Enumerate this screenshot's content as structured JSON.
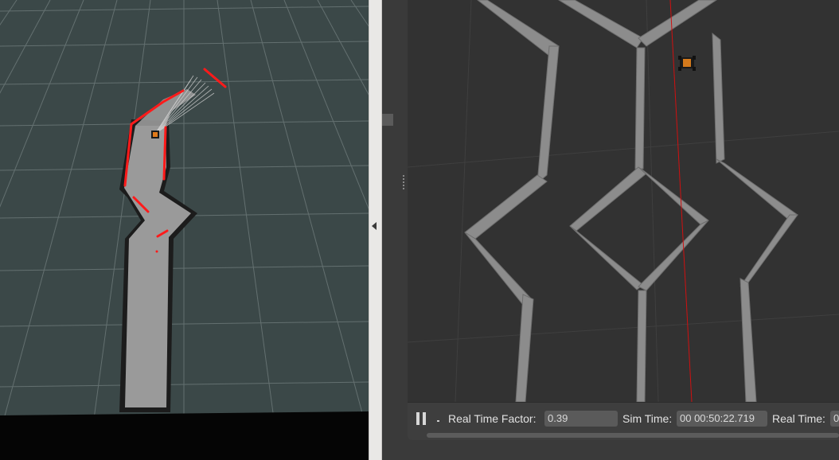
{
  "rviz": {
    "background_color": "#3b4848",
    "grid_color": "#6a7676",
    "map_free_color": "#9a9a9a",
    "laser_color": "#ff1a1a"
  },
  "splitter": {
    "collapse_icon": "triangle-left-icon"
  },
  "gazebo": {
    "background_color": "#323232",
    "wall_color": "#8c8c8c",
    "toolbar": {
      "pause_icon": "pause-icon",
      "real_time_factor_label": "Real Time Factor:",
      "real_time_factor_value": "0.39",
      "sim_time_label": "Sim Time:",
      "sim_time_value": "00 00:50:22.719",
      "real_time_label": "Real Time:",
      "real_time_value": "0"
    }
  }
}
